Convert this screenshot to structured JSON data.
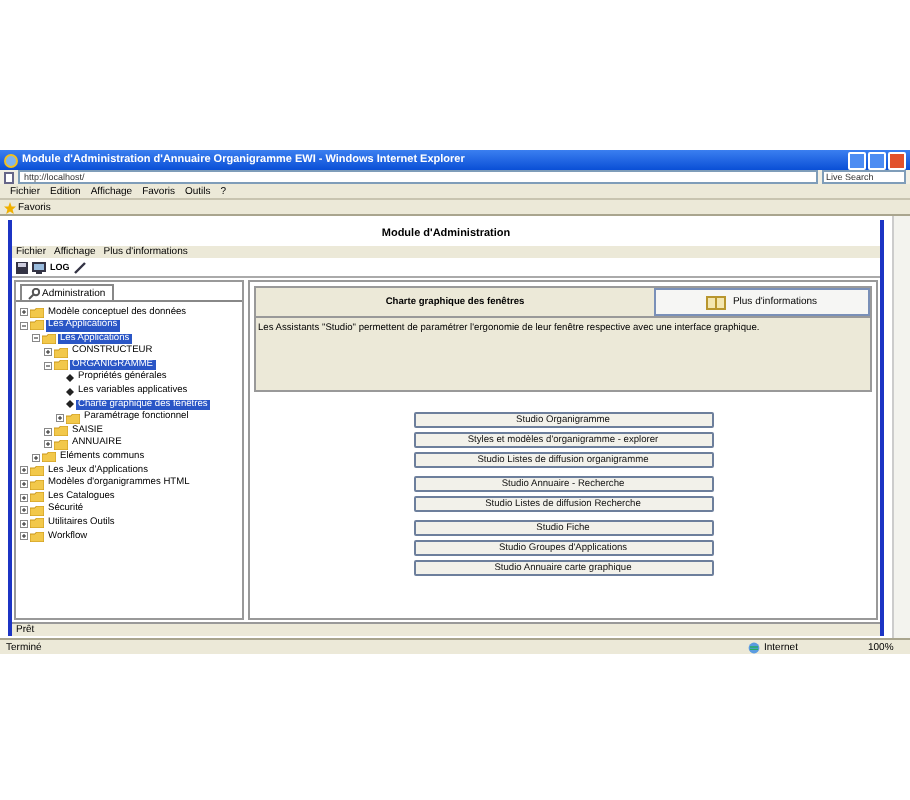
{
  "window": {
    "title": "Module d'Administration d'Annuaire Organigramme EWI - Windows Internet Explorer"
  },
  "address_bar": {
    "url": "http://localhost/",
    "search": "Live Search"
  },
  "browser_menu": [
    "Fichier",
    "Edition",
    "Affichage",
    "Favoris",
    "Outils",
    "?"
  ],
  "favorites_bar": {
    "label": "Favoris"
  },
  "page": {
    "title": "Module d'Administration",
    "app_menu": [
      "Fichier",
      "Affichage",
      "Plus d'informations"
    ],
    "toolbar": {
      "log_label": "LOG"
    },
    "sidebar": {
      "tab": "Administration",
      "tree": [
        {
          "label": "Modèle conceptuel des données",
          "kind": "folder",
          "expanded": false,
          "selected": false
        },
        {
          "label": "Les Applications",
          "kind": "folder",
          "expanded": true,
          "selected": true,
          "children": [
            {
              "label": "Les Applications",
              "kind": "folder",
              "expanded": true,
              "selected": true,
              "children": [
                {
                  "label": "CONSTRUCTEUR",
                  "kind": "folder",
                  "expanded": false,
                  "selected": false
                },
                {
                  "label": "ORGANIGRAMME",
                  "kind": "folder",
                  "expanded": true,
                  "selected": true,
                  "children": [
                    {
                      "label": "Propriétés générales",
                      "kind": "bullet",
                      "selected": false
                    },
                    {
                      "label": "Les variables applicatives",
                      "kind": "bullet",
                      "selected": false
                    },
                    {
                      "label": "Charte graphique des fenêtres",
                      "kind": "bullet",
                      "selected": true
                    },
                    {
                      "label": "Paramétrage fonctionnel",
                      "kind": "folder",
                      "expanded": false,
                      "selected": false
                    }
                  ]
                },
                {
                  "label": "SAISIE",
                  "kind": "folder",
                  "expanded": false,
                  "selected": false
                },
                {
                  "label": "ANNUAIRE",
                  "kind": "folder",
                  "expanded": false,
                  "selected": false
                }
              ]
            },
            {
              "label": "Eléments communs",
              "kind": "folder",
              "expanded": false,
              "selected": false
            }
          ]
        },
        {
          "label": "Les Jeux d'Applications",
          "kind": "folder",
          "expanded": false,
          "selected": false
        },
        {
          "label": "Modèles d'organigrammes HTML",
          "kind": "folder",
          "expanded": false,
          "selected": false
        },
        {
          "label": "Les Catalogues",
          "kind": "folder",
          "expanded": false,
          "selected": false
        },
        {
          "label": "Sécurité",
          "kind": "folder",
          "expanded": false,
          "selected": false
        },
        {
          "label": "Utilitaires Outils",
          "kind": "folder",
          "expanded": false,
          "selected": false
        },
        {
          "label": "Workflow",
          "kind": "folder",
          "expanded": false,
          "selected": false
        }
      ]
    },
    "panel": {
      "heading": "Charte graphique des fenêtres",
      "info_button": "Plus d'informations",
      "description": "Les Assistants \"Studio\" permettent de paramétrer l'ergonomie de leur fenêtre respective avec une interface graphique.",
      "button_groups": [
        [
          "Studio Organigramme",
          "Styles et modèles d'organigramme - explorer",
          "Studio Listes de diffusion organigramme"
        ],
        [
          "Studio Annuaire - Recherche",
          "Studio Listes de diffusion Recherche"
        ],
        [
          "Studio Fiche",
          "Studio Groupes d'Applications",
          "Studio Annuaire carte graphique"
        ]
      ]
    },
    "status": "Prêt"
  },
  "status_bar": {
    "text": "Terminé",
    "zone": "Internet",
    "zoom": "100%"
  }
}
